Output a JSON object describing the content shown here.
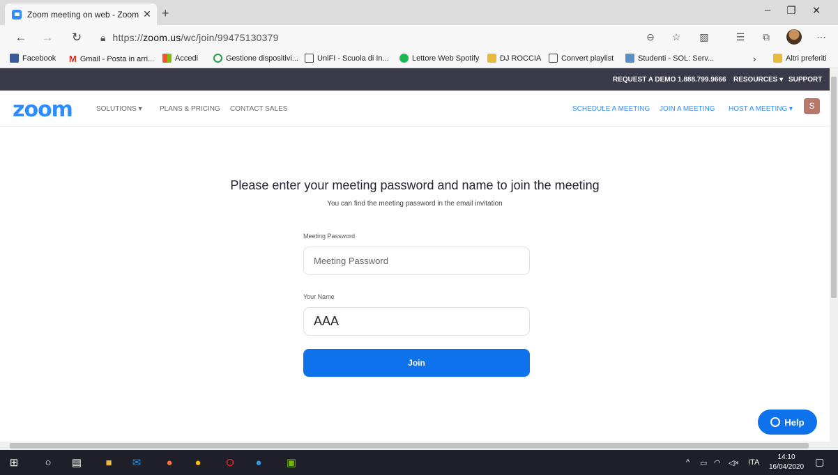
{
  "browser": {
    "tab_title": "Zoom meeting on web - Zoom",
    "url_prefix": "https://",
    "url_domain": "zoom.us",
    "url_path": "/wc/join/99475130379"
  },
  "bookmarks": [
    "Facebook",
    "Gmail - Posta in arri...",
    "Accedi",
    "Gestione dispositivi...",
    "UniFI - Scuola di In...",
    "Lettore Web Spotify",
    "DJ ROCCIA",
    "Convert playlist",
    "Studenti - SOL: Serv...",
    "Altri preferiti"
  ],
  "topstrip": {
    "request_demo": "REQUEST A DEMO",
    "phone": "1.888.799.9666",
    "resources": "RESOURCES ▾",
    "support": "SUPPORT"
  },
  "nav": {
    "logo": "zoom",
    "solutions": "SOLUTIONS ▾",
    "plans": "PLANS & PRICING",
    "contact": "CONTACT SALES",
    "schedule": "SCHEDULE A MEETING",
    "join": "JOIN A MEETING",
    "host": "HOST A MEETING ▾",
    "user_initial": "S"
  },
  "form": {
    "title": "Please enter your meeting password and name to join the meeting",
    "subtitle": "You can find the meeting password in the email invitation",
    "password_label": "Meeting Password",
    "password_placeholder": "Meeting Password",
    "name_label": "Your Name",
    "name_value": "AAA",
    "join_label": "Join"
  },
  "help_label": "Help",
  "taskbar": {
    "language": "ITA",
    "time": "14:10",
    "date": "16/04/2020"
  }
}
